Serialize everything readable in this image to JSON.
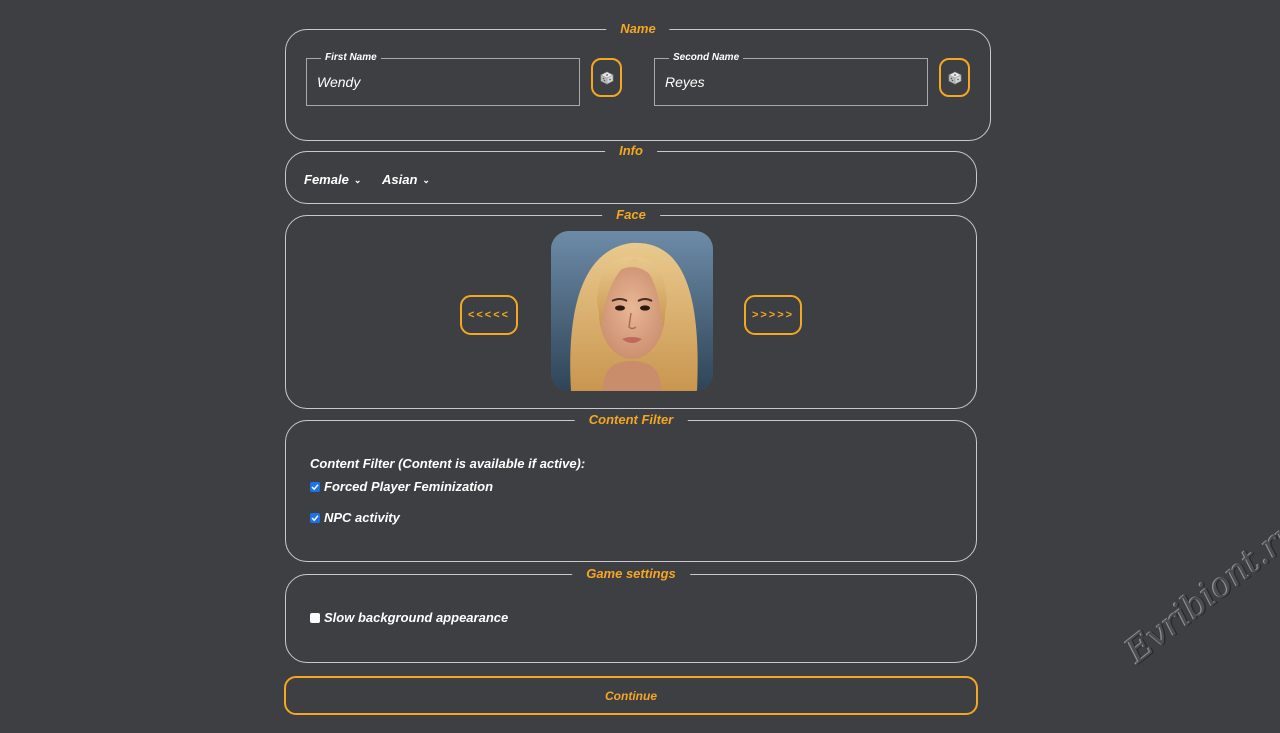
{
  "name_section": {
    "legend": "Name",
    "first_name": {
      "label": "First Name",
      "value": "Wendy"
    },
    "second_name": {
      "label": "Second Name",
      "value": "Reyes"
    },
    "randomize_icon": "dice-icon"
  },
  "info_section": {
    "legend": "Info",
    "gender": "Female",
    "ethnicity": "Asian"
  },
  "face_section": {
    "legend": "Face",
    "prev_label": "<<<<<",
    "next_label": ">>>>>"
  },
  "content_filter": {
    "legend": "Content Filter",
    "title": "Content Filter (Content is available if active):",
    "options": [
      {
        "label": "Forced Player Feminization",
        "checked": true
      },
      {
        "label": "NPC activity",
        "checked": true
      }
    ]
  },
  "game_settings": {
    "legend": "Game settings",
    "options": [
      {
        "label": "Slow background appearance",
        "checked": false
      }
    ]
  },
  "continue_label": "Continue",
  "watermark": "Evribiont.ru",
  "colors": {
    "background": "#3d3f42",
    "accent": "#f5a623",
    "border": "#c9c9c9",
    "checkbox_on": "#1a73e8"
  }
}
